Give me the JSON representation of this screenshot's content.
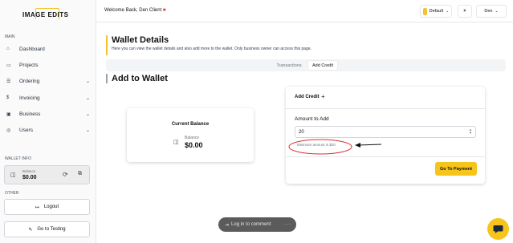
{
  "sidebar": {
    "logo_text": "IMAGE EDITS",
    "main_label": "MAIN",
    "items": [
      {
        "label": "Dashboard",
        "icon": "home-icon"
      },
      {
        "label": "Projects",
        "icon": "folder-icon"
      },
      {
        "label": "Ordering",
        "icon": "list-icon"
      },
      {
        "label": "Invoicing",
        "icon": "dollar-icon"
      },
      {
        "label": "Business",
        "icon": "briefcase-icon"
      },
      {
        "label": "Users",
        "icon": "users-icon"
      }
    ],
    "wallet_info_label": "WALLET INFO",
    "wallet": {
      "balance_label": "Balance",
      "balance_value": "$0.00"
    },
    "other_label": "OTHER",
    "logout_label": "Logout",
    "go_testing_label": "Go to Testing"
  },
  "header": {
    "welcome": "Welcome Back, Den Client",
    "theme_label": "Default",
    "user_label": "Den"
  },
  "page": {
    "title": "Wallet Details",
    "subtitle": "Here you can view the wallet details and also add more to the wallet. Only business owner can access this page.",
    "tabs": [
      "Transactions",
      "Add Credit"
    ],
    "active_tab": "Add Credit",
    "section_title": "Add to Wallet"
  },
  "balance_card": {
    "title": "Current Balance",
    "label": "Balance",
    "value": "$0.00"
  },
  "credit_card": {
    "title": "Add Credit",
    "amount_label": "Amount to Add",
    "amount_value": "20",
    "hint": "Minimum amount is $20",
    "pay_button": "Go To Payment"
  },
  "comment_bar": {
    "label": "Log in to comment"
  },
  "colors": {
    "accent": "#f6c51b",
    "annotation": "#d32f2f"
  }
}
